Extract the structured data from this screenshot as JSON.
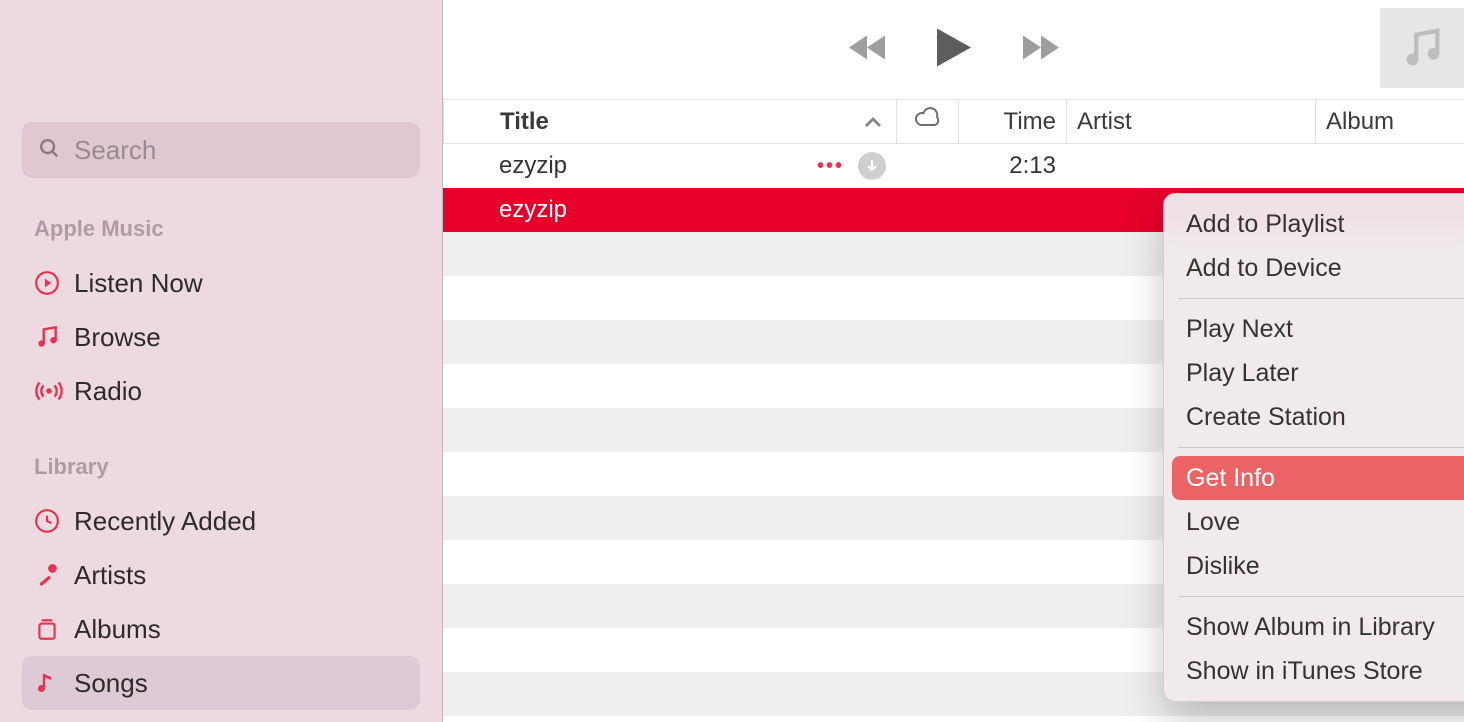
{
  "search": {
    "placeholder": "Search"
  },
  "sidebar": {
    "sections": {
      "apple_music": {
        "label": "Apple Music",
        "items": [
          {
            "label": "Listen Now"
          },
          {
            "label": "Browse"
          },
          {
            "label": "Radio"
          }
        ]
      },
      "library": {
        "label": "Library",
        "items": [
          {
            "label": "Recently Added"
          },
          {
            "label": "Artists"
          },
          {
            "label": "Albums"
          },
          {
            "label": "Songs"
          }
        ]
      }
    }
  },
  "columns": {
    "title": "Title",
    "time": "Time",
    "artist": "Artist",
    "album": "Album"
  },
  "tracks": [
    {
      "title": "ezyzip",
      "time": "2:13",
      "artist": "",
      "album": ""
    },
    {
      "title": "ezyzip",
      "time": "",
      "artist": "",
      "album": ""
    }
  ],
  "context_menu": {
    "items": {
      "add_to_playlist": "Add to Playlist",
      "add_to_device": "Add to Device",
      "play_next": "Play Next",
      "play_later": "Play Later",
      "create_station": "Create Station",
      "get_info": "Get Info",
      "love": "Love",
      "dislike": "Dislike",
      "show_album": "Show Album in Library",
      "show_itunes": "Show in iTunes Store"
    }
  }
}
